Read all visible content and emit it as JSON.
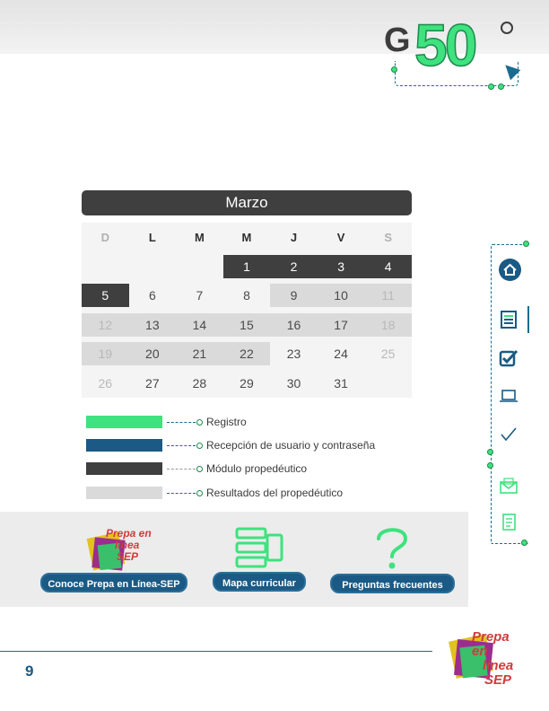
{
  "header": {
    "logo_letter": "G",
    "logo_number": "50"
  },
  "calendar": {
    "month": "Marzo",
    "day_headers": [
      "D",
      "L",
      "M",
      "M",
      "J",
      "V",
      "S"
    ],
    "weeks": [
      [
        {
          "d": "",
          "style": "blank"
        },
        {
          "d": "",
          "style": "blank"
        },
        {
          "d": "",
          "style": "blank"
        },
        {
          "d": "1",
          "style": "dark"
        },
        {
          "d": "2",
          "style": "dark"
        },
        {
          "d": "3",
          "style": "dark"
        },
        {
          "d": "4",
          "style": "dark"
        }
      ],
      [
        {
          "d": "5",
          "style": "dark"
        },
        {
          "d": "6",
          "style": "plain"
        },
        {
          "d": "7",
          "style": "plain"
        },
        {
          "d": "8",
          "style": "plain"
        },
        {
          "d": "9",
          "style": "gray"
        },
        {
          "d": "10",
          "style": "gray"
        },
        {
          "d": "11",
          "style": "gray-muted"
        }
      ],
      [
        {
          "d": "12",
          "style": "gray-muted"
        },
        {
          "d": "13",
          "style": "gray"
        },
        {
          "d": "14",
          "style": "gray"
        },
        {
          "d": "15",
          "style": "gray"
        },
        {
          "d": "16",
          "style": "gray"
        },
        {
          "d": "17",
          "style": "gray"
        },
        {
          "d": "18",
          "style": "gray-muted"
        }
      ],
      [
        {
          "d": "19",
          "style": "gray-muted"
        },
        {
          "d": "20",
          "style": "gray"
        },
        {
          "d": "21",
          "style": "gray"
        },
        {
          "d": "22",
          "style": "gray"
        },
        {
          "d": "23",
          "style": "plain"
        },
        {
          "d": "24",
          "style": "plain"
        },
        {
          "d": "25",
          "style": "muted"
        }
      ],
      [
        {
          "d": "26",
          "style": "muted"
        },
        {
          "d": "27",
          "style": "plain"
        },
        {
          "d": "28",
          "style": "plain"
        },
        {
          "d": "29",
          "style": "plain"
        },
        {
          "d": "30",
          "style": "plain"
        },
        {
          "d": "31",
          "style": "plain"
        },
        {
          "d": "",
          "style": "blank"
        }
      ]
    ]
  },
  "legend": [
    {
      "label": "Registro",
      "color": "#3ee27e"
    },
    {
      "label": "Recepción de usuario y contraseña",
      "color": "#1a5a84"
    },
    {
      "label": "Módulo propedéutico",
      "color": "#3f3f3f"
    },
    {
      "label": "Resultados del propedéutico",
      "color": "#dadada"
    }
  ],
  "links": {
    "conoce": "Conoce Prepa en Línea-SEP",
    "mapa": "Mapa curricular",
    "preguntas": "Preguntas frecuentes"
  },
  "prepa_logo": {
    "line1": "Prepa en",
    "line2": "línea",
    "line3": "SEP"
  },
  "sidenav": {
    "icons": [
      "home-icon",
      "checklist-icon",
      "checkbox-icon",
      "laptop-icon",
      "checkmark-icon",
      "mail-icon",
      "document-icon"
    ]
  },
  "footer": {
    "page_number": "9"
  },
  "colors": {
    "accent_green": "#3ee27e",
    "brand_blue": "#1a5a84",
    "dark": "#3f3f3f",
    "light_gray": "#dadada"
  }
}
